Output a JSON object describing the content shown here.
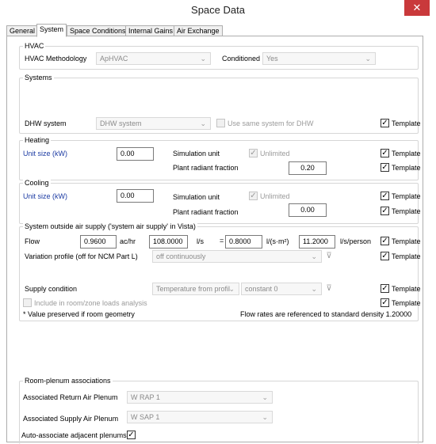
{
  "window": {
    "title": "Space Data",
    "close_glyph": "✕"
  },
  "tabs": [
    "General",
    "System",
    "Space Conditions",
    "Internal Gains",
    "Air Exchange"
  ],
  "hvac": {
    "group_label": "HVAC",
    "methodology_label": "HVAC Methodology",
    "methodology_value": "ApHVAC",
    "conditioned_label": "Conditioned",
    "conditioned_value": "Yes"
  },
  "systems": {
    "group_label": "Systems",
    "dhw_label": "DHW system",
    "dhw_value": "DHW system",
    "same_system_label": "Use same system for DHW",
    "template_label": "Template"
  },
  "heating": {
    "group_label": "Heating",
    "unit_size_label": "Unit size (kW)",
    "unit_size_value": "0.00",
    "sim_unit_label": "Simulation unit",
    "unlimited_label": "Unlimited",
    "radiant_label": "Plant radiant fraction",
    "radiant_value": "0.20",
    "template_label": "Template"
  },
  "cooling": {
    "group_label": "Cooling",
    "unit_size_label": "Unit size (kW)",
    "unit_size_value": "0.00",
    "sim_unit_label": "Simulation unit",
    "unlimited_label": "Unlimited",
    "radiant_label": "Plant radiant fraction",
    "radiant_value": "0.00",
    "template_label": "Template"
  },
  "air_supply": {
    "group_label": "System outside air supply ('system air supply' in Vista)",
    "flow_label": "Flow",
    "flow_ach": "0.9600",
    "unit_ach": "ac/hr",
    "flow_ls": "108.0000",
    "unit_ls": "l/s",
    "eq": "=",
    "flow_lsm2": "0.8000",
    "unit_lsm2": "l/(s·m²)",
    "flow_lsp": "11.2000",
    "unit_lsp": "l/s/person",
    "variation_label": "Variation profile (off for NCM Part L)",
    "variation_value": "off continuously",
    "supply_label": "Supply condition",
    "supply_type": "Temperature from profil",
    "supply_profile": "constant 0",
    "include_label": "Include in room/zone loads analysis",
    "note": "* Value preserved if room geometry",
    "density_note": "Flow rates are referenced to standard density 1.20000",
    "template_label": "Template"
  },
  "plenum": {
    "group_label": "Room-plenum associations",
    "return_label": "Associated Return Air Plenum",
    "return_value": "W RAP 1",
    "supply_label": "Associated Supply Air Plenum",
    "supply_value": "W SAP 1",
    "auto_label": "Auto-associate adjacent plenums"
  },
  "icons": {
    "check": "✓",
    "chevron": "⌄",
    "filter": "⊽"
  },
  "colors": {
    "close": "#c9393b",
    "label_blue": "#1c3ba3"
  }
}
